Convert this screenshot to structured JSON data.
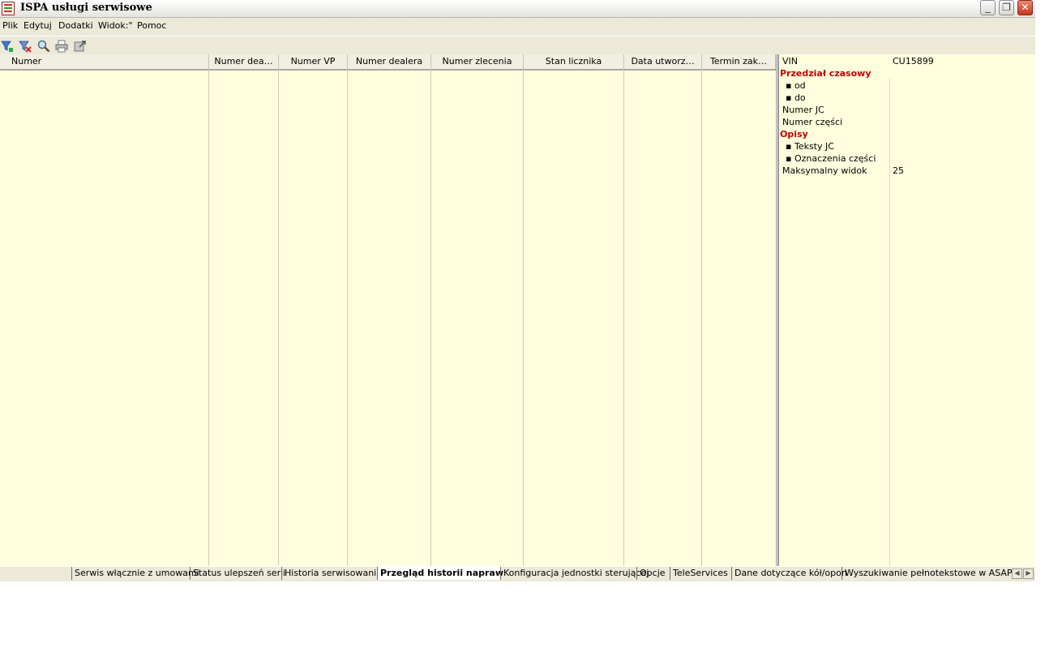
{
  "window": {
    "title": "ISPA usługi serwisowe",
    "controls": {
      "minimize": "_",
      "restore": "❐",
      "close": "✕"
    }
  },
  "menu": {
    "items": [
      "Plik",
      "Edytuj",
      "Dodatki",
      "Widok:\"",
      "Pomoc"
    ]
  },
  "toolbar": {
    "icons": [
      "filter-add-icon",
      "filter-remove-icon",
      "search-icon",
      "print-icon",
      "export-icon"
    ]
  },
  "grid": {
    "columns": [
      "Numer",
      "Numer dea…",
      "Numer VP",
      "Numer dealera",
      "Numer zlecenia",
      "Stan licznika",
      "Data utworz…",
      "Termin zak…"
    ],
    "rows": []
  },
  "properties": {
    "vin_label": "VIN",
    "vin_value": "CU15899",
    "section_time": "Przedział czasowy",
    "from_label": "▪ od",
    "to_label": "▪ do",
    "jc_number_label": "Numer JC",
    "part_number_label": "Numer części",
    "section_desc": "Opisy",
    "jc_texts_label": "▪ Teksty JC",
    "part_marks_label": "▪ Oznaczenia części",
    "max_view_label": "Maksymalny widok",
    "max_view_value": "25",
    "section_color": "#c00000"
  },
  "tabs": {
    "items": [
      "Serwis włącznie z umowami",
      "Status ulepszeń serii",
      "Historia serwisowania",
      "Przegląd historii napraw",
      "Konfiguracja jednostki sterującej",
      "Opcje",
      "TeleServices",
      "Dane dotyczące kół/opon",
      "Wyszukiwanie pełnotekstowe w ASAP"
    ],
    "active": "Przegląd historii napraw",
    "scroll_left": "◀",
    "scroll_right": "▶"
  },
  "colors": {
    "grid_background": "#ffffdf",
    "chrome": "#ece9d8"
  }
}
